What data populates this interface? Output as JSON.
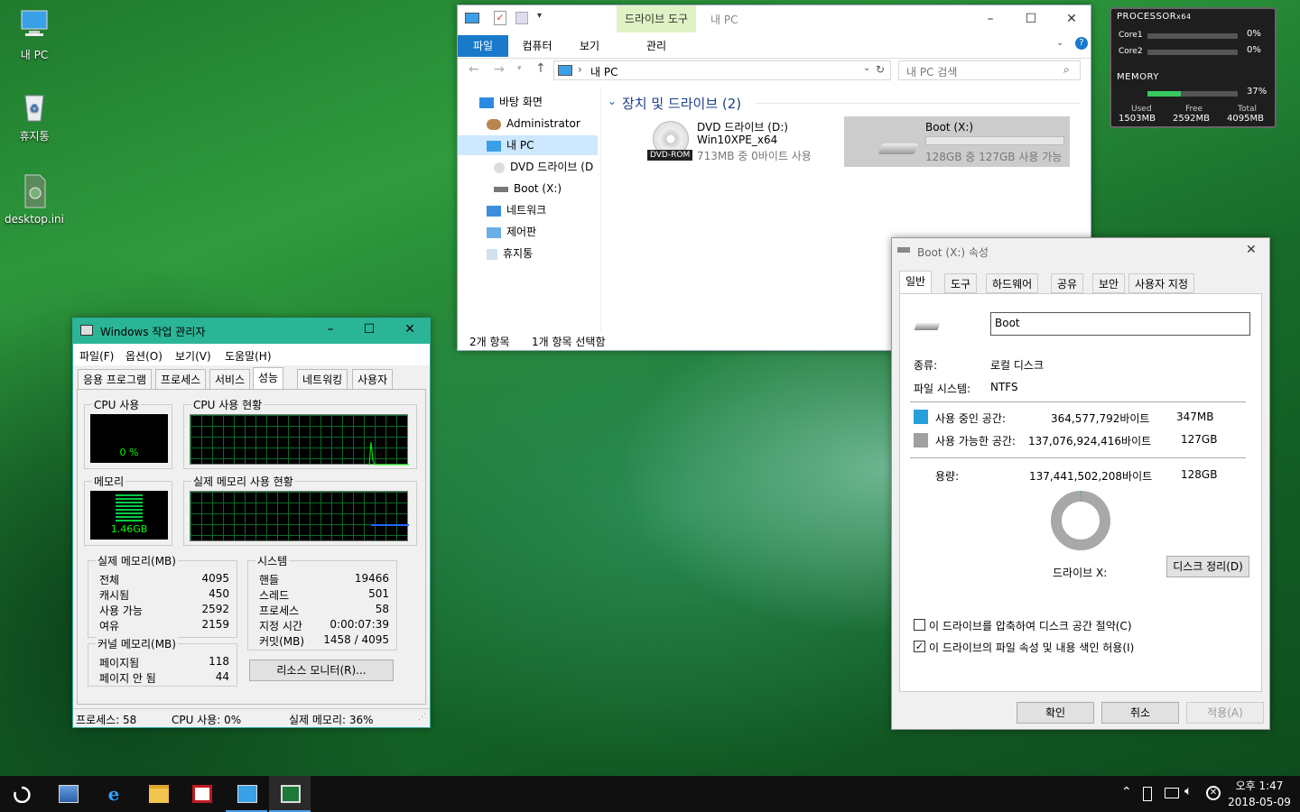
{
  "desktop": {
    "icons": [
      {
        "label": "내 PC"
      },
      {
        "label": "휴지통"
      },
      {
        "label": "desktop.ini"
      }
    ]
  },
  "explorer": {
    "title": "내 PC",
    "context_tab": "드라이브 도구",
    "context_sub": "관리",
    "ribbon_tabs": [
      "파일",
      "컴퓨터",
      "보기"
    ],
    "address": "내 PC",
    "search_placeholder": "내 PC 검색",
    "nav": [
      "바탕 화면",
      "Administrator",
      "내 PC",
      "DVD 드라이브 (D",
      "Boot (X:)",
      "네트워크",
      "제어판",
      "휴지통"
    ],
    "group_header": "장치 및 드라이브 (2)",
    "dvd": {
      "name": "DVD 드라이브 (D:)",
      "label": "Win10XPE_x64",
      "usage": "713MB 중 0바이트 사용",
      "badge": "DVD-ROM"
    },
    "boot": {
      "name": "Boot (X:)",
      "usage": "128GB 중 127GB 사용 가능"
    },
    "status_items": "2개 항목",
    "status_selected": "1개 항목 선택함"
  },
  "taskmgr": {
    "title": "Windows 작업 관리자",
    "menu": [
      "파일(F)",
      "옵션(O)",
      "보기(V)",
      "도움말(H)"
    ],
    "tabs": [
      "응용 프로그램",
      "프로세스",
      "서비스",
      "성능",
      "네트워킹",
      "사용자"
    ],
    "cpu_label": "CPU 사용",
    "cpu_value": "0 %",
    "cpu_history_label": "CPU 사용 현황",
    "mem_label": "메모리",
    "mem_value": "1.46GB",
    "mem_history_label": "실제 메모리 사용 현황",
    "physical_title": "실제 메모리(MB)",
    "physical": [
      {
        "k": "전체",
        "v": "4095"
      },
      {
        "k": "캐시됨",
        "v": "450"
      },
      {
        "k": "사용 가능",
        "v": "2592"
      },
      {
        "k": "여유",
        "v": "2159"
      }
    ],
    "kernel_title": "커널 메모리(MB)",
    "kernel": [
      {
        "k": "페이지됨",
        "v": "118"
      },
      {
        "k": "페이지 안 됨",
        "v": "44"
      }
    ],
    "system_title": "시스템",
    "system": [
      {
        "k": "핸들",
        "v": "19466"
      },
      {
        "k": "스레드",
        "v": "501"
      },
      {
        "k": "프로세스",
        "v": "58"
      },
      {
        "k": "지정 시간",
        "v": "0:00:07:39"
      },
      {
        "k": "커밋(MB)",
        "v": "1458 / 4095"
      }
    ],
    "resource_monitor_btn": "리소스 모니터(R)...",
    "status_processes": "프로세스: 58",
    "status_cpu": "CPU 사용: 0%",
    "status_mem": "실제 메모리: 36%"
  },
  "props": {
    "title": "Boot (X:) 속성",
    "tabs": [
      "일반",
      "도구",
      "하드웨어",
      "공유",
      "보안",
      "사용자 지정"
    ],
    "name_value": "Boot",
    "type_label": "종류:",
    "type_value": "로컬 디스크",
    "fs_label": "파일 시스템:",
    "fs_value": "NTFS",
    "used_label": "사용 중인 공간:",
    "used_bytes": "364,577,792바이트",
    "used_short": "347MB",
    "free_label": "사용 가능한 공간:",
    "free_bytes": "137,076,924,416바이트",
    "free_short": "127GB",
    "cap_label": "용량:",
    "cap_bytes": "137,441,502,208바이트",
    "cap_short": "128GB",
    "drive_label": "드라이브 X:",
    "cleanup_btn": "디스크 정리(D)",
    "compress_label": "이 드라이브를 압축하여 디스크 공간 절약(C)",
    "index_label": "이 드라이브의 파일 속성 및 내용 색인 허용(I)",
    "ok": "확인",
    "cancel": "취소",
    "apply": "적용(A)",
    "used_color": "#26a0da",
    "free_color": "#a0a0a0"
  },
  "widget": {
    "processor_label": "PROCESSOR",
    "processor_arch": "x64",
    "core1_label": "Core1",
    "core1_value": "0%",
    "core2_label": "Core2",
    "core2_value": "0%",
    "memory_label": "MEMORY",
    "memory_value": "37%",
    "memory_fraction": 0.37,
    "used_label": "Used",
    "used_value": "1503MB",
    "free_label": "Free",
    "free_value": "2592MB",
    "total_label": "Total",
    "total_value": "4095MB"
  },
  "taskbar": {
    "time": "오후 1:47",
    "date": "2018-05-09"
  }
}
